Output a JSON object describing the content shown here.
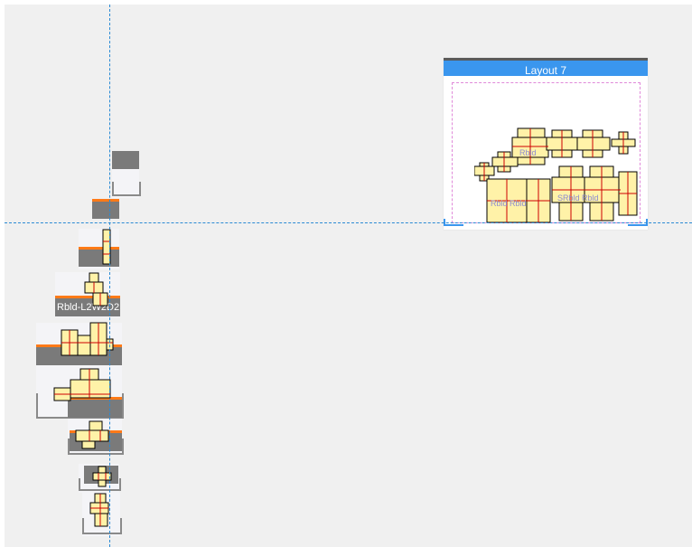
{
  "layout_card": {
    "title": "Layout 7"
  },
  "left_labels": {
    "label_1": "Rbld-L2W2D2"
  },
  "nest_labels": {
    "label_1": "Rbld",
    "label_2": "Rbld Rbld",
    "label_3": "SRbld Rbld"
  },
  "colors": {
    "accent": "#3a96ee",
    "part_fill": "#fff2a8",
    "part_stroke": "#cc0000",
    "panel_bar": "#7a7a7a",
    "orange": "#ff7a18",
    "guide": "#2a8ad4"
  }
}
